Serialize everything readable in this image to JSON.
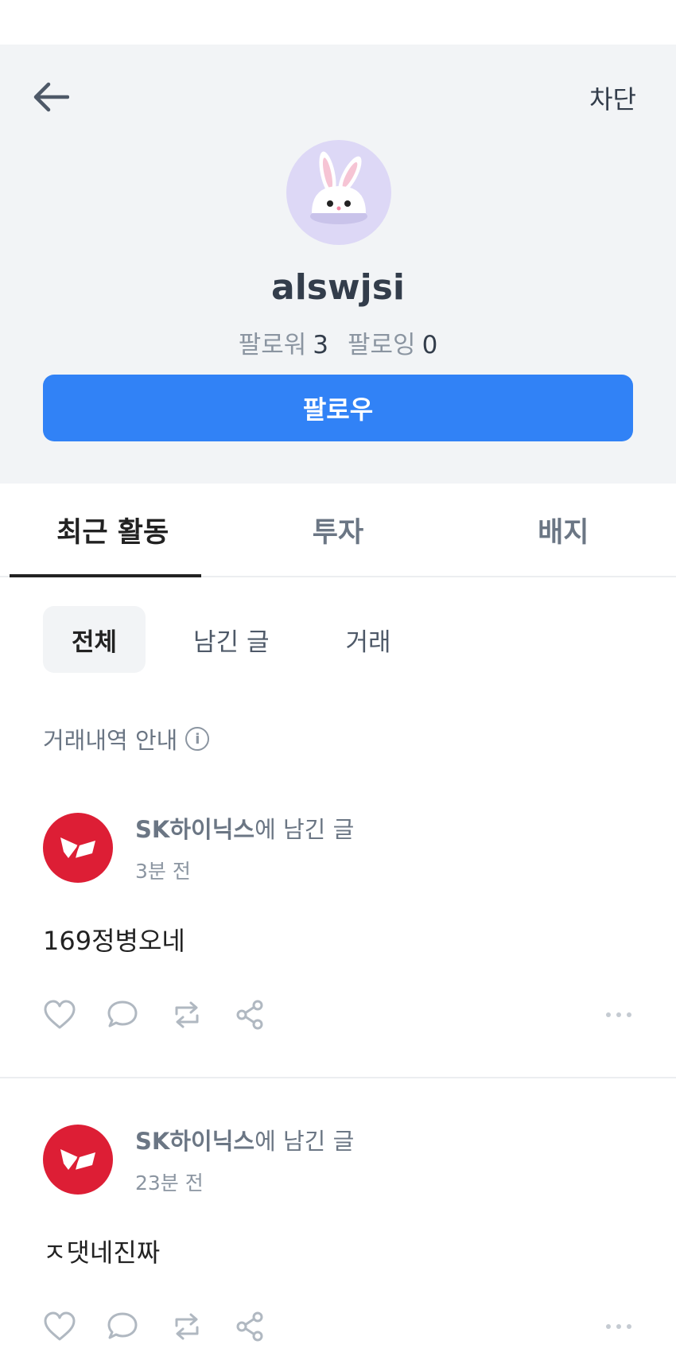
{
  "header": {
    "block_label": "차단"
  },
  "profile": {
    "username": "alswjsi",
    "followers_label": "팔로워",
    "followers_count": "3",
    "following_label": "팔로잉",
    "following_count": "0",
    "follow_button": "팔로우"
  },
  "tabs": [
    {
      "label": "최근 활동",
      "active": true
    },
    {
      "label": "투자",
      "active": false
    },
    {
      "label": "배지",
      "active": false
    }
  ],
  "subtabs": [
    {
      "label": "전체",
      "active": true
    },
    {
      "label": "남긴 글",
      "active": false
    },
    {
      "label": "거래",
      "active": false
    }
  ],
  "trade_info_label": "거래내역 안내",
  "posts": [
    {
      "stock": "SK하이닉스",
      "suffix": "에 남긴 글",
      "time": "3분 전",
      "body": "169정병오네"
    },
    {
      "stock": "SK하이닉스",
      "suffix": "에 남긴 글",
      "time": "23분 전",
      "body": "ㅈ댓네진짜"
    }
  ],
  "colors": {
    "accent": "#3182f6",
    "stock_logo": "#dd1e35",
    "profile_bg": "#f2f4f6"
  }
}
